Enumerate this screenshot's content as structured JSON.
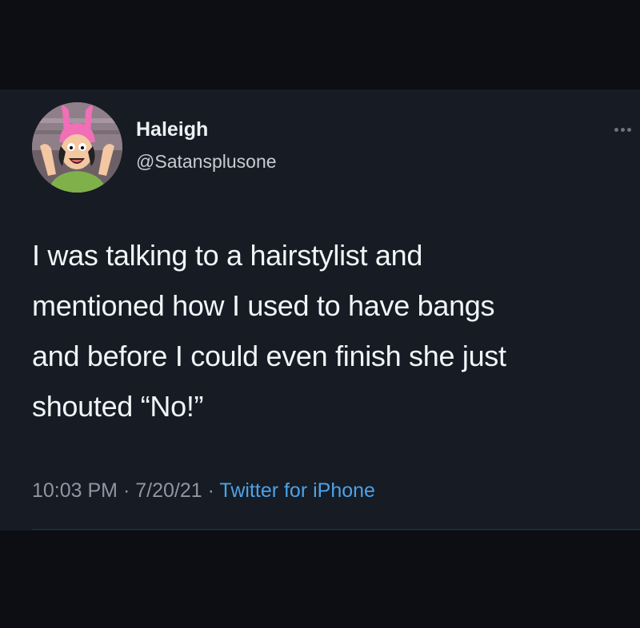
{
  "tweet": {
    "author": {
      "display_name": "Haleigh",
      "handle": "@Satansplusone",
      "avatar_icon": "cartoon-girl-pink-bunny-ears-avatar"
    },
    "more_icon": "more-horizontal-icon",
    "text_lines": [
      "I was talking to a hairstylist and",
      "mentioned how I used to have bangs",
      "and before I could even finish she just",
      "shouted “No!”"
    ],
    "meta": {
      "time": "10:03 PM",
      "separator": " · ",
      "date": "7/20/21",
      "source": "Twitter for iPhone"
    }
  },
  "colors": {
    "background": "#0e1015",
    "card": "#161b24",
    "text_primary": "#f2f4f6",
    "text_secondary": "#8d96a2",
    "link": "#4da2e6"
  }
}
